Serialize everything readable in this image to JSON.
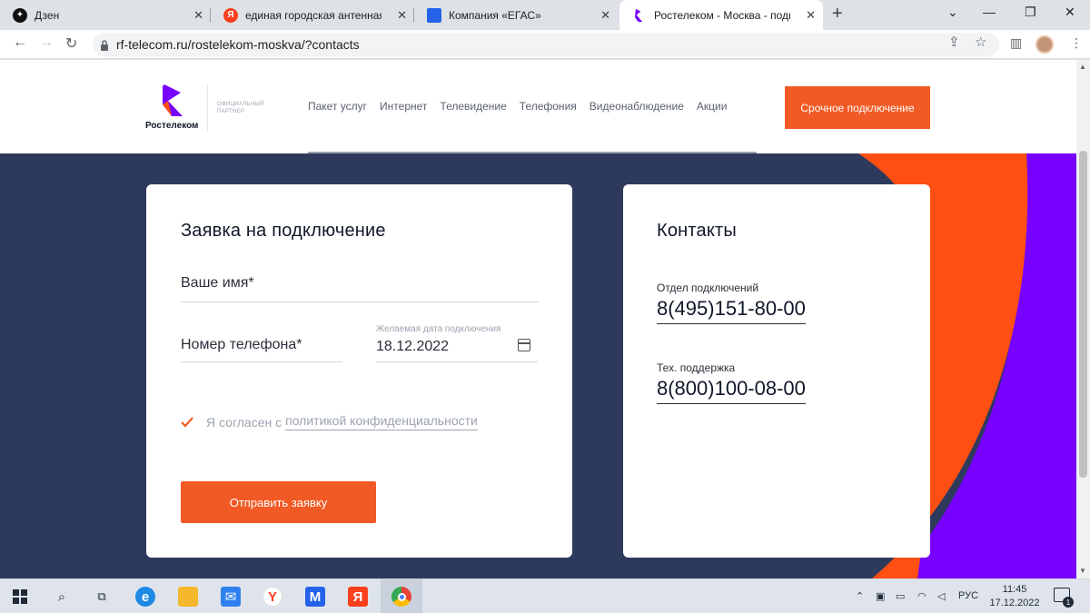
{
  "browser": {
    "tabs": [
      {
        "title": "Дзен",
        "icon": "dzen-icon",
        "favicon_color": "#111111"
      },
      {
        "title": "единая городская антенная служба",
        "icon": "yandex-icon",
        "favicon_color": "#fc3f1d"
      },
      {
        "title": "Компания «ЕГАС»",
        "icon": "egas-icon",
        "favicon_color": "#2563eb"
      },
      {
        "title": "Ростелеком - Москва - подключение",
        "icon": "rostelecom-icon",
        "favicon_color": "#7700ff"
      }
    ],
    "url": "rf-telecom.ru/rostelekom-moskva/?contacts"
  },
  "site": {
    "logo_text": "Ростелеком",
    "partner_text": "ОФИЦИАЛЬНЫЙ ПАРТНЕР",
    "menu": [
      "Пакет услуг",
      "Интернет",
      "Телевидение",
      "Телефония",
      "Видеонаблюдение",
      "Акции"
    ],
    "cta_label": "Срочное подключение",
    "colors": {
      "brand_orange": "#f15a24",
      "brand_purple": "#7700ff",
      "background_navy": "#2d3a5c"
    }
  },
  "form": {
    "title": "Заявка на подключение",
    "name_placeholder": "Ваше имя*",
    "phone_placeholder": "Номер телефона*",
    "date_label": "Желаемая дата подключения",
    "date_value": "18.12.2022",
    "consent_text": "Я согласен с",
    "consent_link": "политикой конфиденциальности",
    "consent_checked": true,
    "submit_label": "Отправить заявку"
  },
  "contacts": {
    "title": "Контакты",
    "items": [
      {
        "label": "Отдел подключений",
        "phone": "8(495)151-80-00"
      },
      {
        "label": "Тех. поддержка",
        "phone": "8(800)100-08-00"
      }
    ]
  },
  "taskbar": {
    "language": "РУС",
    "time": "11:45",
    "date": "17.12.2022",
    "notification_count": "1"
  }
}
